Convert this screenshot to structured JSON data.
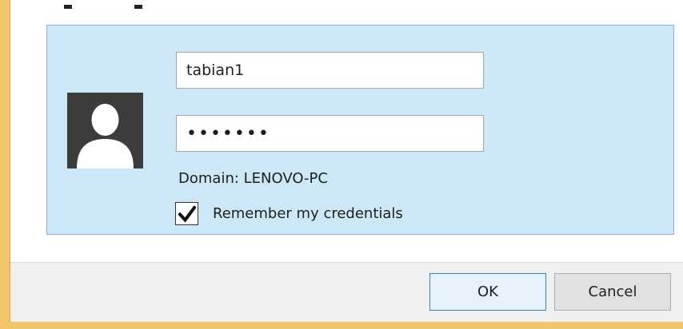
{
  "credentials": {
    "username_value": "tabian1",
    "password_masked": "•••••••",
    "domain_label": "Domain: LENOVO-PC",
    "remember_label": "Remember my credentials",
    "remember_checked": true
  },
  "buttons": {
    "ok_label": "OK",
    "cancel_label": "Cancel"
  },
  "icons": {
    "avatar": "user-avatar-icon",
    "checkmark": "checkmark-icon"
  },
  "colors": {
    "panel_background": "#cce8f6",
    "panel_border": "#7eb4ea",
    "window_frame": "#f2c46c",
    "ok_border": "#3c7fb1"
  }
}
